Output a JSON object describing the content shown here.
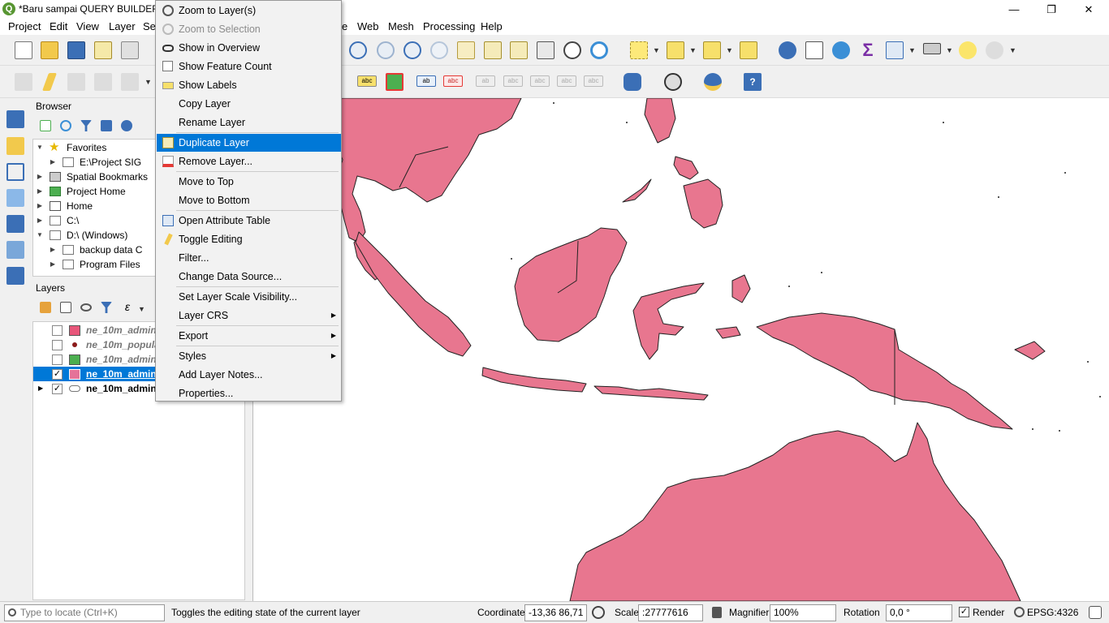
{
  "window": {
    "title": "*Baru sampai QUERY BUILDER –",
    "minimize": "—",
    "restore": "❐",
    "close": "✕"
  },
  "menubar": [
    "Project",
    "Edit",
    "View",
    "Layer",
    "Set",
    "e",
    "Web",
    "Mesh",
    "Processing",
    "Help"
  ],
  "browser": {
    "title": "Browser",
    "items": [
      {
        "label": "Favorites",
        "icon": "star-icon",
        "expanded": true
      },
      {
        "label": "E:\\Project SIG",
        "icon": "folder-icon"
      },
      {
        "label": "Spatial Bookmarks",
        "icon": "bookmark-icon"
      },
      {
        "label": "Project Home",
        "icon": "project-home-icon"
      },
      {
        "label": "Home",
        "icon": "home-icon"
      },
      {
        "label": "C:\\",
        "icon": "drive-icon"
      },
      {
        "label": "D:\\ (Windows)",
        "icon": "drive-icon",
        "expanded": true
      },
      {
        "label": "backup data C",
        "icon": "folder-icon"
      },
      {
        "label": "Program Files",
        "icon": "folder-icon"
      }
    ]
  },
  "layers": {
    "title": "Layers",
    "items": [
      {
        "name": "ne_10m_admin",
        "checked": false,
        "symbol": "#e8567a",
        "style": "italic"
      },
      {
        "name": "ne_10m_popula",
        "checked": false,
        "symbol": "point",
        "style": "italic"
      },
      {
        "name": "ne_10m_admin",
        "checked": false,
        "symbol": "#4caf50",
        "style": "italic"
      },
      {
        "name": "ne_10m_admin",
        "checked": true,
        "symbol": "#e57399",
        "style": "selected"
      },
      {
        "name": "ne_10m_admin",
        "checked": true,
        "symbol": "group",
        "style": "bold"
      }
    ],
    "check_mark": "✓"
  },
  "context_menu": {
    "items": [
      {
        "label": "Zoom to Layer(s)",
        "icon": "zoom-layer-icon"
      },
      {
        "label": "Zoom to Selection",
        "icon": "zoom-selection-icon",
        "disabled": true
      },
      {
        "label": "Show in Overview",
        "icon": "overview-icon"
      },
      {
        "label": "Show Feature Count",
        "icon": "checkbox-icon"
      },
      {
        "label": "Show Labels",
        "icon": "labels-icon"
      },
      {
        "label": "Copy Layer"
      },
      {
        "label": "Rename Layer"
      },
      {
        "label": "Duplicate Layer",
        "icon": "duplicate-icon",
        "highlighted": true
      },
      {
        "label": "Remove Layer...",
        "icon": "remove-icon"
      },
      {
        "label": "Move to Top"
      },
      {
        "label": "Move to Bottom"
      },
      {
        "label": "Open Attribute Table",
        "icon": "table-icon"
      },
      {
        "label": "Toggle Editing",
        "icon": "pencil-icon"
      },
      {
        "label": "Filter..."
      },
      {
        "label": "Change Data Source..."
      },
      {
        "label": "Set Layer Scale Visibility..."
      },
      {
        "label": "Layer CRS",
        "submenu": true
      },
      {
        "label": "Export",
        "submenu": true
      },
      {
        "label": "Styles",
        "submenu": true
      },
      {
        "label": "Add Layer Notes..."
      },
      {
        "label": "Properties..."
      }
    ],
    "submenu_arrow": "▶"
  },
  "statusbar": {
    "locate_placeholder": "Type to locate (Ctrl+K)",
    "message": "Toggles the editing state of the current layer",
    "coordinate_label": "Coordinate",
    "coordinate_value": "-13,36 86,71",
    "scale_label": "Scale",
    "scale_value": ":27777616",
    "magnifier_label": "Magnifier",
    "magnifier_value": "100%",
    "rotation_label": "Rotation",
    "rotation_value": "0,0 °",
    "render_label": "Render",
    "render_check": "✓",
    "crs": "EPSG:4326"
  },
  "colors": {
    "land": "#e8768f",
    "highlight": "#0078d7"
  }
}
